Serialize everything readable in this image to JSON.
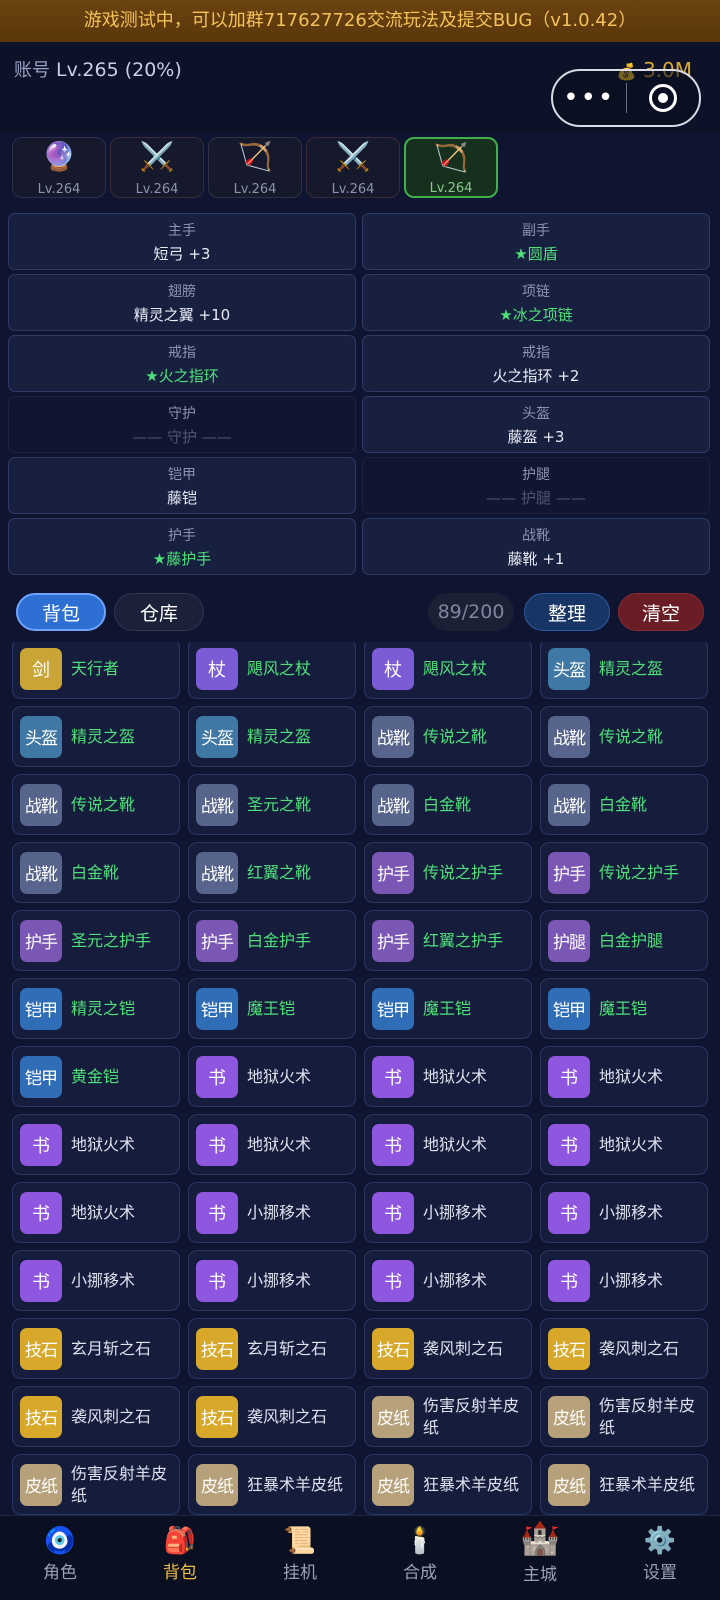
{
  "banner": "游戏测试中，可以加群717627726交流玩法及提交BUG（v1.0.42）",
  "account": {
    "label": "账号",
    "level": "Lv.265 (20%)"
  },
  "gold": "3.0M",
  "capsule": {
    "more": "•••",
    "target": "target-icon"
  },
  "characters": [
    {
      "icon": "🔮",
      "level": "Lv.264"
    },
    {
      "icon": "⚔️",
      "level": "Lv.264"
    },
    {
      "icon": "🏹",
      "level": "Lv.264"
    },
    {
      "icon": "⚔️",
      "level": "Lv.264"
    },
    {
      "icon": "🏹",
      "level": "Lv.264"
    }
  ],
  "equipment": [
    {
      "slot": "主手",
      "item": "短弓 +3",
      "star": false,
      "empty": false
    },
    {
      "slot": "副手",
      "item": "★圆盾",
      "star": true,
      "empty": false
    },
    {
      "slot": "翅膀",
      "item": "精灵之翼 +10",
      "star": false,
      "empty": false
    },
    {
      "slot": "项链",
      "item": "★冰之项链",
      "star": true,
      "empty": false
    },
    {
      "slot": "戒指",
      "item": "★火之指环",
      "star": true,
      "empty": false
    },
    {
      "slot": "戒指",
      "item": "火之指环 +2",
      "star": false,
      "empty": false
    },
    {
      "slot": "守护",
      "item": "—— 守护 ——",
      "star": false,
      "empty": true
    },
    {
      "slot": "头盔",
      "item": "藤盔 +3",
      "star": false,
      "empty": false
    },
    {
      "slot": "铠甲",
      "item": "藤铠",
      "star": false,
      "empty": false
    },
    {
      "slot": "护腿",
      "item": "—— 护腿 ——",
      "star": false,
      "empty": true
    },
    {
      "slot": "护手",
      "item": "★藤护手",
      "star": true,
      "empty": false
    },
    {
      "slot": "战靴",
      "item": "藤靴 +1",
      "star": false,
      "empty": false
    }
  ],
  "tabs": {
    "bag": "背包",
    "storage": "仓库"
  },
  "capacity": "89/200",
  "actions": {
    "sort": "整理",
    "clear": "清空"
  },
  "colors": {
    "sword": "#c8a536",
    "staff": "#7b5cd6",
    "helmet": "#3f78a4",
    "boots": "#57648c",
    "gloves": "#7a57b4",
    "legs": "#7a57b4",
    "armor": "#2f6eb6",
    "book": "#8f56e0",
    "stone": "#d7a82a",
    "scroll": "#b6a17a"
  },
  "bag": [
    {
      "tag": "剑",
      "kind": "sword",
      "name": "天行者",
      "green": true
    },
    {
      "tag": "杖",
      "kind": "staff",
      "name": "飓风之杖",
      "green": true
    },
    {
      "tag": "杖",
      "kind": "staff",
      "name": "飓风之杖",
      "green": true
    },
    {
      "tag": "头盔",
      "kind": "helmet",
      "name": "精灵之盔",
      "green": true
    },
    {
      "tag": "头盔",
      "kind": "helmet",
      "name": "精灵之盔",
      "green": true
    },
    {
      "tag": "头盔",
      "kind": "helmet",
      "name": "精灵之盔",
      "green": true
    },
    {
      "tag": "战靴",
      "kind": "boots",
      "name": "传说之靴",
      "green": true
    },
    {
      "tag": "战靴",
      "kind": "boots",
      "name": "传说之靴",
      "green": true
    },
    {
      "tag": "战靴",
      "kind": "boots",
      "name": "传说之靴",
      "green": true
    },
    {
      "tag": "战靴",
      "kind": "boots",
      "name": "圣元之靴",
      "green": true
    },
    {
      "tag": "战靴",
      "kind": "boots",
      "name": "白金靴",
      "green": true
    },
    {
      "tag": "战靴",
      "kind": "boots",
      "name": "白金靴",
      "green": true
    },
    {
      "tag": "战靴",
      "kind": "boots",
      "name": "白金靴",
      "green": true
    },
    {
      "tag": "战靴",
      "kind": "boots",
      "name": "红翼之靴",
      "green": true
    },
    {
      "tag": "护手",
      "kind": "gloves",
      "name": "传说之护手",
      "green": true
    },
    {
      "tag": "护手",
      "kind": "gloves",
      "name": "传说之护手",
      "green": true
    },
    {
      "tag": "护手",
      "kind": "gloves",
      "name": "圣元之护手",
      "green": true
    },
    {
      "tag": "护手",
      "kind": "gloves",
      "name": "白金护手",
      "green": true
    },
    {
      "tag": "护手",
      "kind": "gloves",
      "name": "红翼之护手",
      "green": true
    },
    {
      "tag": "护腿",
      "kind": "legs",
      "name": "白金护腿",
      "green": true
    },
    {
      "tag": "铠甲",
      "kind": "armor",
      "name": "精灵之铠",
      "green": true
    },
    {
      "tag": "铠甲",
      "kind": "armor",
      "name": "魔王铠",
      "green": true
    },
    {
      "tag": "铠甲",
      "kind": "armor",
      "name": "魔王铠",
      "green": true
    },
    {
      "tag": "铠甲",
      "kind": "armor",
      "name": "魔王铠",
      "green": true
    },
    {
      "tag": "铠甲",
      "kind": "armor",
      "name": "黄金铠",
      "green": true
    },
    {
      "tag": "书",
      "kind": "book",
      "name": "地狱火术",
      "green": false
    },
    {
      "tag": "书",
      "kind": "book",
      "name": "地狱火术",
      "green": false
    },
    {
      "tag": "书",
      "kind": "book",
      "name": "地狱火术",
      "green": false
    },
    {
      "tag": "书",
      "kind": "book",
      "name": "地狱火术",
      "green": false
    },
    {
      "tag": "书",
      "kind": "book",
      "name": "地狱火术",
      "green": false
    },
    {
      "tag": "书",
      "kind": "book",
      "name": "地狱火术",
      "green": false
    },
    {
      "tag": "书",
      "kind": "book",
      "name": "地狱火术",
      "green": false
    },
    {
      "tag": "书",
      "kind": "book",
      "name": "地狱火术",
      "green": false
    },
    {
      "tag": "书",
      "kind": "book",
      "name": "小挪移术",
      "green": false
    },
    {
      "tag": "书",
      "kind": "book",
      "name": "小挪移术",
      "green": false
    },
    {
      "tag": "书",
      "kind": "book",
      "name": "小挪移术",
      "green": false
    },
    {
      "tag": "书",
      "kind": "book",
      "name": "小挪移术",
      "green": false
    },
    {
      "tag": "书",
      "kind": "book",
      "name": "小挪移术",
      "green": false
    },
    {
      "tag": "书",
      "kind": "book",
      "name": "小挪移术",
      "green": false
    },
    {
      "tag": "书",
      "kind": "book",
      "name": "小挪移术",
      "green": false
    },
    {
      "tag": "技石",
      "kind": "stone",
      "name": "玄月斩之石",
      "green": false
    },
    {
      "tag": "技石",
      "kind": "stone",
      "name": "玄月斩之石",
      "green": false
    },
    {
      "tag": "技石",
      "kind": "stone",
      "name": "袭风刺之石",
      "green": false
    },
    {
      "tag": "技石",
      "kind": "stone",
      "name": "袭风刺之石",
      "green": false
    },
    {
      "tag": "技石",
      "kind": "stone",
      "name": "袭风刺之石",
      "green": false
    },
    {
      "tag": "技石",
      "kind": "stone",
      "name": "袭风刺之石",
      "green": false
    },
    {
      "tag": "皮纸",
      "kind": "scroll",
      "name": "伤害反射羊皮纸",
      "green": false
    },
    {
      "tag": "皮纸",
      "kind": "scroll",
      "name": "伤害反射羊皮纸",
      "green": false
    },
    {
      "tag": "皮纸",
      "kind": "scroll",
      "name": "伤害反射羊皮纸",
      "green": false
    },
    {
      "tag": "皮纸",
      "kind": "scroll",
      "name": "狂暴术羊皮纸",
      "green": false
    },
    {
      "tag": "皮纸",
      "kind": "scroll",
      "name": "狂暴术羊皮纸",
      "green": false
    },
    {
      "tag": "皮纸",
      "kind": "scroll",
      "name": "狂暴术羊皮纸",
      "green": false
    }
  ],
  "nav": [
    {
      "icon": "🧿",
      "label": "角色",
      "active": false,
      "name": "nav-character"
    },
    {
      "icon": "🎒",
      "label": "背包",
      "active": true,
      "name": "nav-bag"
    },
    {
      "icon": "📜",
      "label": "挂机",
      "active": false,
      "name": "nav-idle"
    },
    {
      "icon": "🕯️",
      "label": "合成",
      "active": false,
      "name": "nav-craft"
    },
    {
      "icon": "🏰",
      "label": "主城",
      "active": false,
      "name": "nav-city"
    },
    {
      "icon": "⚙️",
      "label": "设置",
      "active": false,
      "name": "nav-settings"
    }
  ]
}
